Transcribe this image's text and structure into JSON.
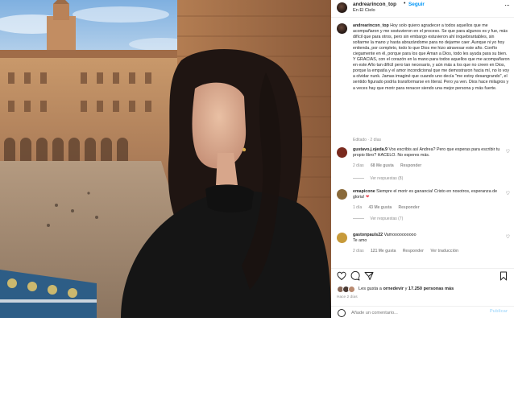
{
  "post": {
    "username": "andrearincon_top",
    "follow_label": "Seguir",
    "separator": "•",
    "location": "En El Cielo",
    "more_label": "···"
  },
  "caption": {
    "username": "andrearincon_top",
    "text": "Hoy solo quiero agradecer a todos aquellos que me acompañaron y me sostuvieron en el proceso. Se que para algunos es y fue, más difícil que para otros, pero sin embargo estuvieron ahí inquebrantables, sin soltarme la mano y hasta abrazándome para no dejarme caer. Aunque ni yo hoy entienda, por completo, todo lo que Dios me hizo atravesar este año. Confío ciegamente en él, porque para los que Aman a Dios, todo les ayuda para su bien. Y GRACIAS, con el corazón en la mano para todos aquellos que me acompañaron en este Año tan difícil pero tan necesario, y aún más a los que no creen en Dios, porque la empatía y el amor incondicional que me demostraron hacia mí, no lo voy a olvidar nunk. Jamas imaginé que cuando uno decía \"me estoy desangrando\", el sentido figurado podría transformarse en literal. Pero ya ven. Dios hace milagros y a veces hay que morir para renacer siendo una mejor persona y más fuerte.",
    "meta": "Editado · 2 días"
  },
  "comments": [
    {
      "username": "gustavo.j.ojeda.9",
      "text": "Vos escribis así Andrea? Pero que esperas para escribir tu propio libro? HACELO. No esperes más.",
      "time": "2 días",
      "likes": "68 Me gusta",
      "reply": "Responder",
      "translate": "",
      "replies": "Ver respuestas (8)",
      "avatar_color": "#7a2a1e"
    },
    {
      "username": "emapicone",
      "text": "Siempre el morir es ganancia! Cristo en nosotros, esperanza de gloria!",
      "heart": "❤",
      "time": "1 día",
      "likes": "43 Me gusta",
      "reply": "Responder",
      "translate": "",
      "replies": "Ver respuestas (7)",
      "avatar_color": "#8a6a3a"
    },
    {
      "username": "gastonpauls22",
      "text": "Vamoooooooooo",
      "second_line": "Te amo",
      "time": "2 días",
      "likes": "121 Me gusta",
      "reply": "Responder",
      "translate": "Ver traducción",
      "replies": "",
      "avatar_color": "#c79a3a"
    }
  ],
  "likes": {
    "prefix": "Les gusta a",
    "user": "ornedevir",
    "connector": "y",
    "count": "17.250 personas más",
    "ago": "Hace 2 días"
  },
  "composer": {
    "placeholder": "Añade un comentario...",
    "publish_label": "Publicar"
  },
  "icons": {
    "like": "heart-icon",
    "comment": "comment-icon",
    "share": "share-icon",
    "save": "bookmark-icon",
    "emoji": "emoji-icon",
    "more": "more-icon"
  }
}
